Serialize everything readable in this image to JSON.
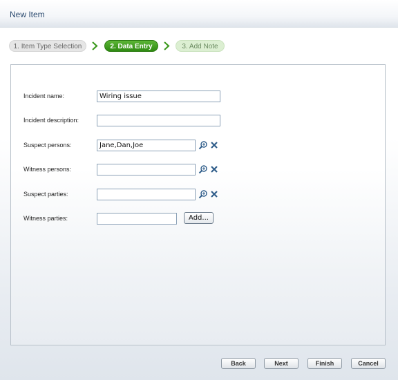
{
  "window": {
    "title": "New Item"
  },
  "wizard": {
    "steps": [
      {
        "label": "1. Item Type Selection",
        "state": "done"
      },
      {
        "label": "2. Data Entry",
        "state": "active"
      },
      {
        "label": "3. Add Note",
        "state": "upcoming"
      }
    ]
  },
  "form": {
    "incident_name": {
      "label": "Incident name:",
      "value": "Wiring issue"
    },
    "incident_description": {
      "label": "Incident description:",
      "value": ""
    },
    "suspect_persons": {
      "label": "Suspect persons:",
      "value": "Jane,Dan,Joe"
    },
    "witness_persons": {
      "label": "Witness persons:",
      "value": ""
    },
    "suspect_parties": {
      "label": "Suspect parties:",
      "value": ""
    },
    "witness_parties": {
      "label": "Witness parties:",
      "value": "",
      "add_label": "Add..."
    }
  },
  "footer": {
    "back_label": "Back",
    "next_label": "Next",
    "finish_label": "Finish",
    "cancel_label": "Cancel"
  },
  "colors": {
    "active_step": "#3d9a1f",
    "title_text": "#2b4a6f",
    "lookup_icon": "#2f5d8a",
    "clear_icon": "#2f5d8a"
  }
}
